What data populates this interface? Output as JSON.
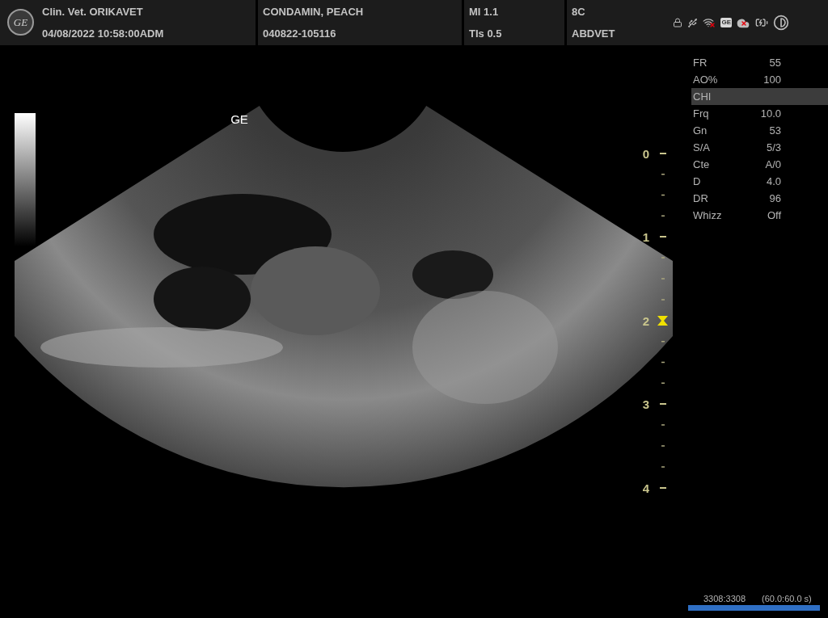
{
  "header": {
    "logo": "GE",
    "cells": [
      {
        "top": "Clin. Vet. ORIKAVET",
        "bottom": "04/08/2022 10:58:00ADM"
      },
      {
        "top": "CONDAMIN, PEACH",
        "bottom": "040822-105116"
      },
      {
        "top": "MI 1.1",
        "bottom": "TIs 0.5"
      },
      {
        "top": "8C",
        "bottom": "ABDVET"
      }
    ],
    "status_badge": "GE"
  },
  "image": {
    "orientation_mark": "GE",
    "depth_scale": [
      {
        "label": "0",
        "focus": false
      },
      {
        "label": "1",
        "focus": false
      },
      {
        "label": "2",
        "focus": true
      },
      {
        "label": "3",
        "focus": false
      },
      {
        "label": "4",
        "focus": false
      }
    ]
  },
  "parameters": [
    {
      "label": "FR",
      "value": "55",
      "selected": false
    },
    {
      "label": "AO%",
      "value": "100",
      "selected": false
    },
    {
      "label": "CHI",
      "selected": true
    },
    {
      "label": "Frq",
      "value": "10.0",
      "selected": false
    },
    {
      "label": "Gn",
      "value": "53",
      "selected": false
    },
    {
      "label": "S/A",
      "value": "5/3",
      "selected": false
    },
    {
      "label": "Cte",
      "value": "A/0",
      "selected": false
    },
    {
      "label": "D",
      "value": "4.0",
      "selected": false
    },
    {
      "label": "DR",
      "value": "96",
      "selected": false
    },
    {
      "label": "Whizz",
      "value": "Off",
      "selected": false
    }
  ],
  "cine": {
    "frames": "3308:3308",
    "time": "(60.0:60.0 s)",
    "level": 1
  }
}
